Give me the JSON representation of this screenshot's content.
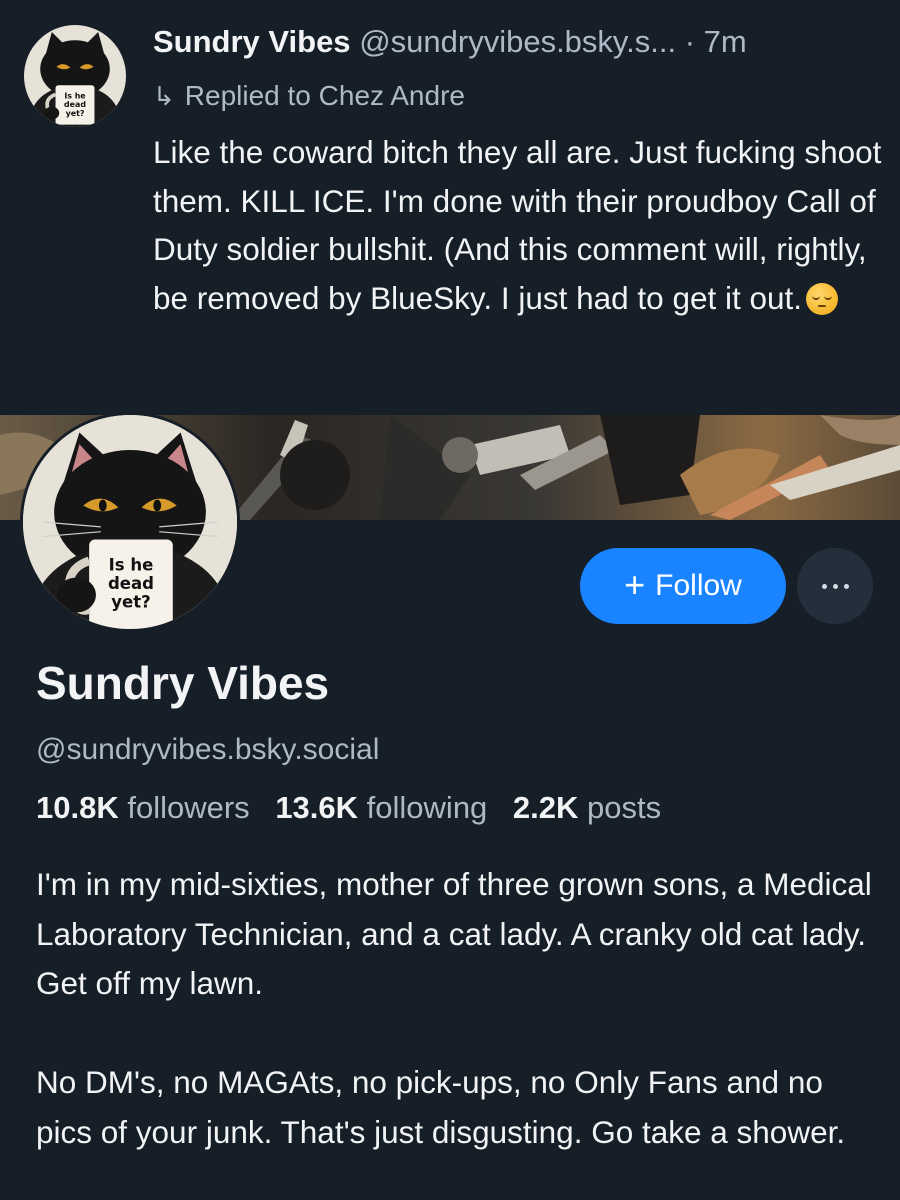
{
  "post": {
    "author_name": "Sundry Vibes",
    "author_handle": "@sundryvibes.bsky.s...",
    "separator": "·",
    "time": "7m",
    "reply_label": "Replied to Chez Andre",
    "text": "Like the coward bitch they all are. Just fucking shoot them. KILL ICE. I'm done with their proudboy Call of Duty soldier bullshit. (And this comment will, rightly, be removed by BlueSky. I just had to get it out.",
    "emoji": "pensive-face"
  },
  "avatar": {
    "mug_text": "Is he dead yet?"
  },
  "profile": {
    "name": "Sundry Vibes",
    "handle": "@sundryvibes.bsky.social",
    "follow_label": "Follow",
    "stats": {
      "followers_count": "10.8K",
      "followers_label": "followers",
      "following_count": "13.6K",
      "following_label": "following",
      "posts_count": "2.2K",
      "posts_label": "posts"
    },
    "bio": [
      "I'm in my mid-sixties, mother of three grown sons, a Medical Laboratory Technician, and a cat lady. A cranky old cat lady. Get off my lawn.",
      "No DM's, no MAGAts, no pick-ups, no Only Fans and no pics of your junk. That's just disgusting. Go take a shower."
    ]
  },
  "colors": {
    "background": "#161e27",
    "accent": "#1a83ff",
    "muted_text": "#aeb9c6"
  }
}
